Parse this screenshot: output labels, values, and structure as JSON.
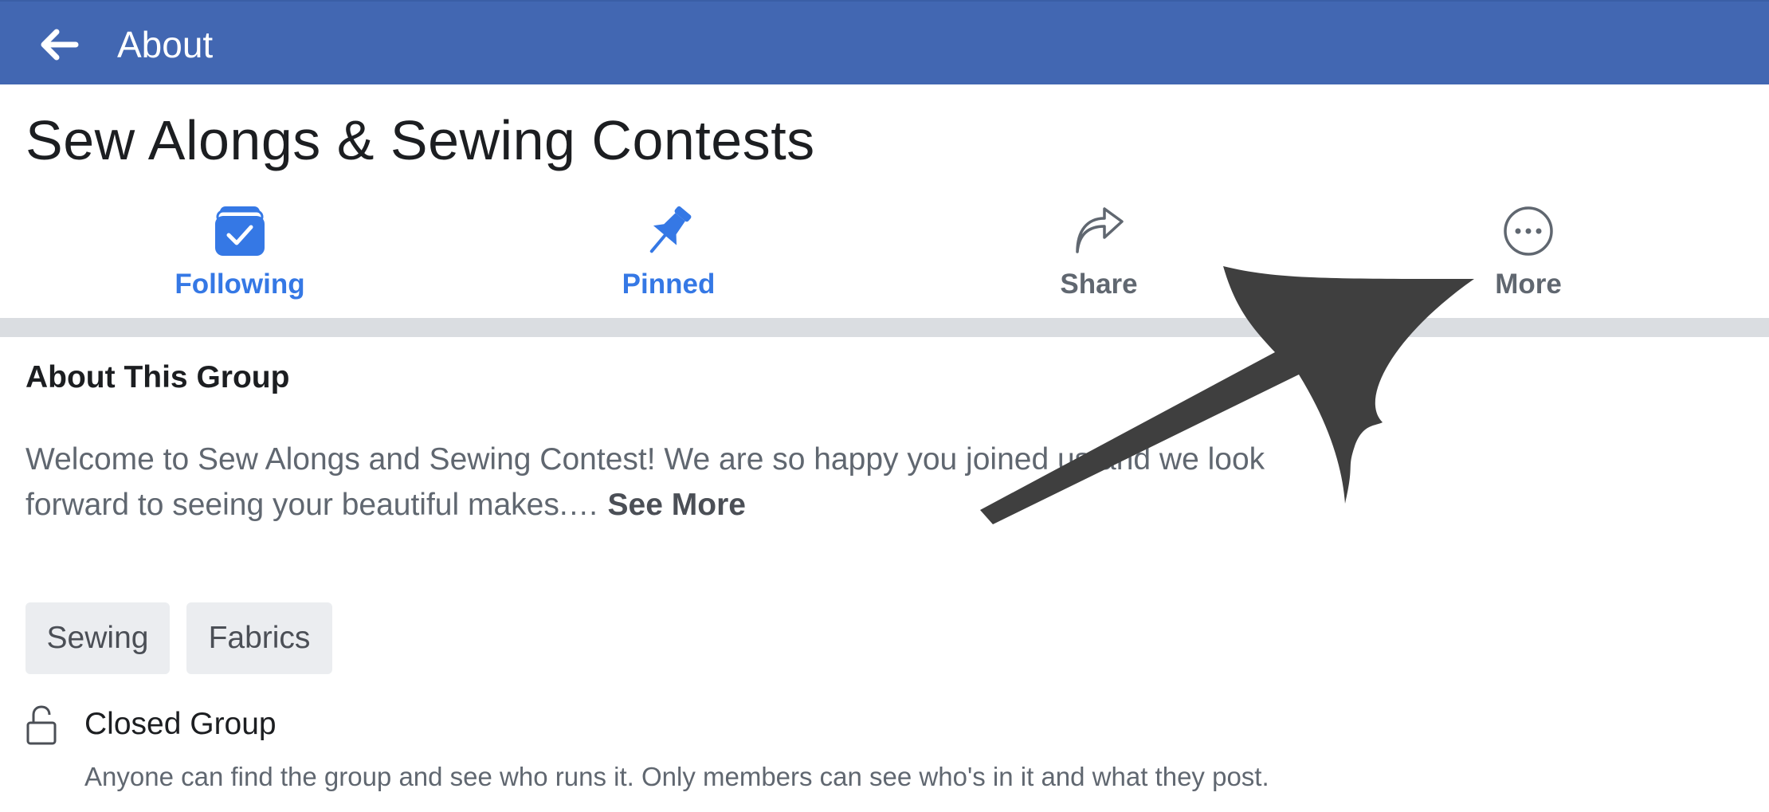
{
  "topbar": {
    "title": "About",
    "back_icon": "arrow-left-icon",
    "background": "#4267b2"
  },
  "group": {
    "name": "Sew Alongs & Sewing Contests"
  },
  "actions": [
    {
      "label": "Following",
      "icon": "following-check-icon",
      "color": "#3578e5"
    },
    {
      "label": "Pinned",
      "icon": "pin-icon",
      "color": "#3578e5"
    },
    {
      "label": "Share",
      "icon": "share-arrow-icon",
      "color": "#606770"
    },
    {
      "label": "More",
      "icon": "more-dots-icon",
      "color": "#606770"
    }
  ],
  "about": {
    "heading": "About This Group",
    "description": "Welcome to Sew Alongs and Sewing Contest!  We are so happy you joined us and we look forward to seeing your beautiful makes.…",
    "see_more": "See More"
  },
  "tags": [
    "Sewing",
    "Fabrics"
  ],
  "privacy": {
    "title": "Closed Group",
    "description": "Anyone can find the group and see who runs it. Only members can see who's in it and what they post.",
    "icon": "lock-open-icon"
  },
  "annotation": {
    "icon": "pointer-arrow-icon",
    "color": "#3f3f3f"
  }
}
